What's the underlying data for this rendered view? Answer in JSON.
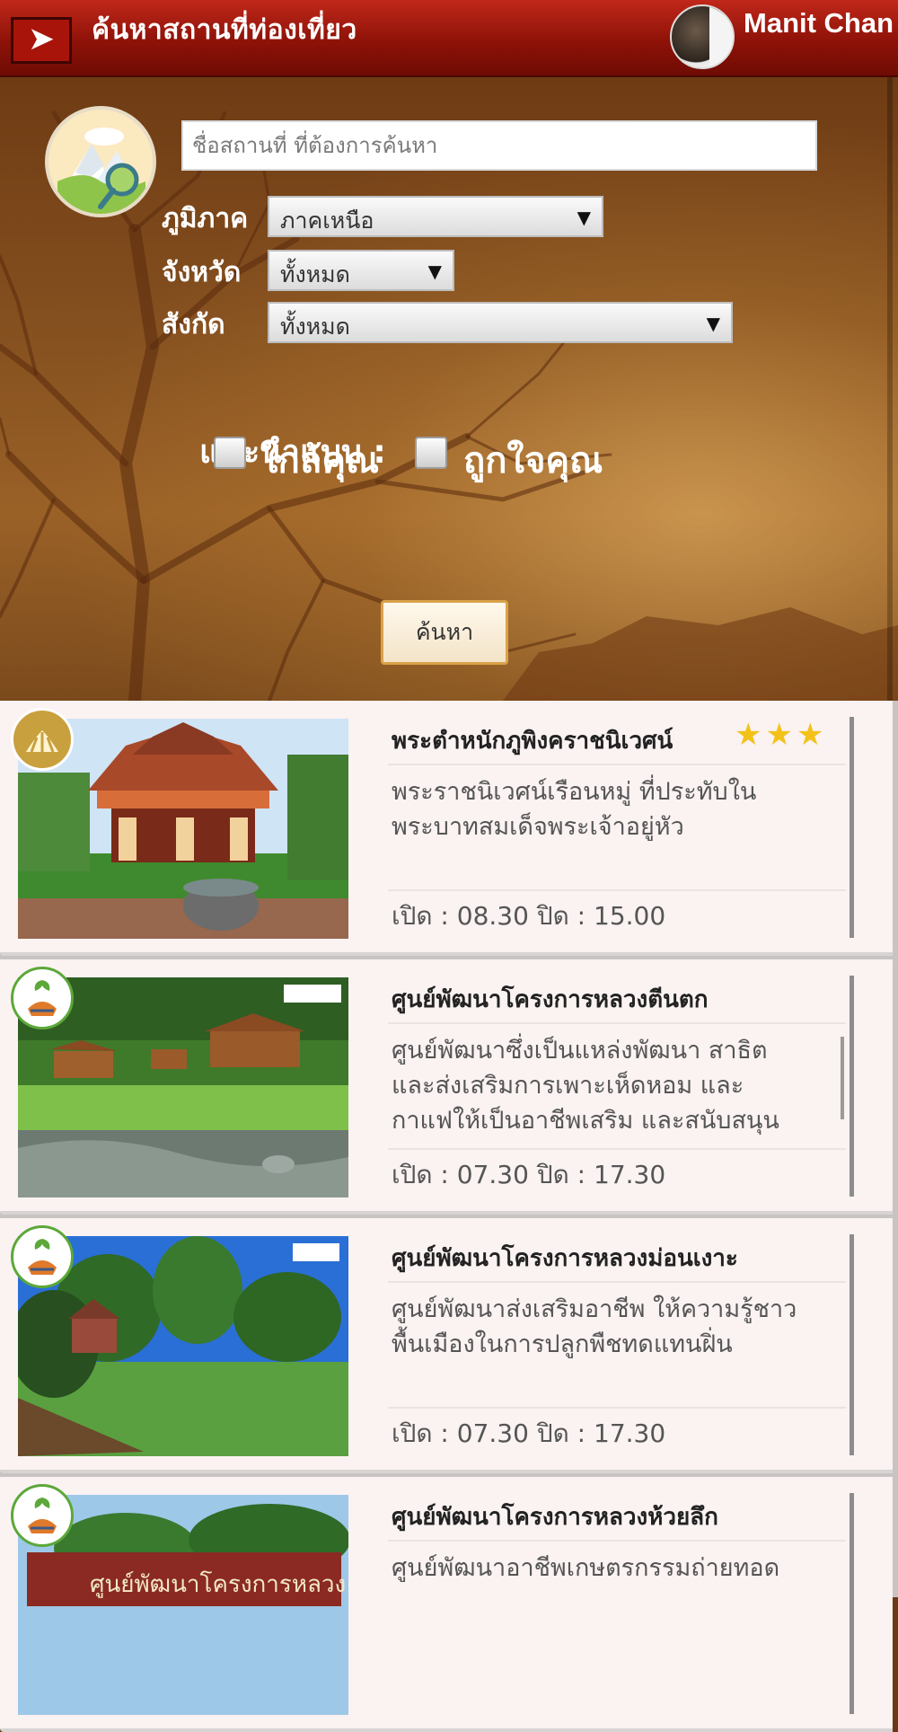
{
  "header": {
    "back_icon": "back-arrow-icon",
    "title": "ค้นหาสถานที่ท่องเที่ยว",
    "user_name": "Manit Chan"
  },
  "search": {
    "placeholder": "ชื่อสถานที่ ที่ต้องการค้นหา",
    "region_label": "ภูมิภาค",
    "region_value": "ภาคเหนือ",
    "province_label": "จังหวัด",
    "province_value": "ทั้งหมด",
    "affiliation_label": "สังกัด",
    "affiliation_value": "ทั้งหมด",
    "recommend_label": "แนะนำแบบ :",
    "option_near": "ใกล้คุณ",
    "option_liked": "ถูกใจคุณ",
    "button_label": "ค้นหา"
  },
  "results": [
    {
      "title": "พระตำหนักภูพิงคราชนิเวศน์",
      "rating_stars": 3,
      "description": "พระราชนิเวศน์เรือนหมู่ ที่ประทับใน\nพระบาทสมเด็จพระเจ้าอยู่หัว",
      "hours": "เปิด : 08.30 ปิด : 15.00",
      "badge": "royal-emblem-icon"
    },
    {
      "title": "ศูนย์พัฒนาโครงการหลวงตีนตก",
      "description": "ศูนย์พัฒนาซึ่งเป็นแหล่งพัฒนา สาธิต\nและส่งเสริมการเพาะเห็ดหอม และ\nกาแฟให้เป็นอาชีพเสริม และสนับสนุน",
      "hours": "เปิด : 07.30 ปิด : 17.30",
      "badge": "royal-project-icon"
    },
    {
      "title": "ศูนย์พัฒนาโครงการหลวงม่อนเงาะ",
      "description": "ศูนย์พัฒนาส่งเสริมอาชีพ ให้ความรู้ชาว\nพื้นเมืองในการปลูกพืชทดแทนฝิ่น",
      "hours": "เปิด : 07.30 ปิด : 17.30",
      "badge": "royal-project-icon"
    },
    {
      "title": "ศูนย์พัฒนาโครงการหลวงห้วยลึก",
      "description": "ศูนย์พัฒนาอาชีพเกษตรกรรมถ่ายทอด",
      "hours": "",
      "badge": "royal-project-icon"
    }
  ]
}
